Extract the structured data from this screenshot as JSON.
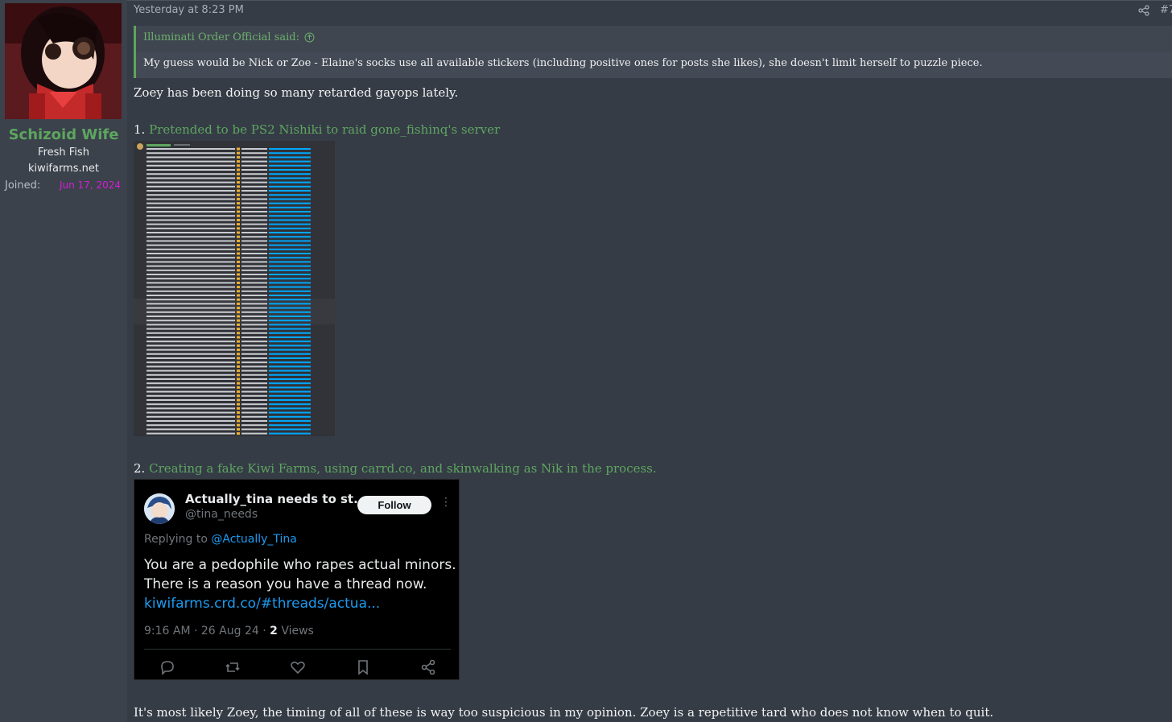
{
  "author": {
    "username": "Schizoid Wife",
    "title": "Fresh Fish",
    "site": "kiwifarms.net",
    "joined_label": "Joined:",
    "joined_date": "Jun 17, 2024",
    "avatar_icon": "anime-avatar-icon"
  },
  "post": {
    "timestamp": "Yesterday at 8:23 PM",
    "number": "#7",
    "quote": {
      "author_line": "Illuminati Order Official said:",
      "body": "My guess would be Nick or Zoe - Elaine's socks use all available stickers (including positive ones for posts she likes), she doesn't limit herself to puzzle piece."
    },
    "paragraph1": "Zoey has been doing so many retarded gayops lately.",
    "item1": {
      "prefix": "1. ",
      "link_text": "Pretended to be PS2 Nishiki to raid gone_fishinq's server"
    },
    "item2": {
      "prefix": "2. ",
      "link_text": "Creating a fake Kiwi Farms, using carrd.co, and skinwalking as Nik in the process."
    },
    "closing": "It's most likely Zoey, the timing of all of these is way too suspicious in my opinion. Zoey is a repetitive tard who does not know when to quit."
  },
  "tweet": {
    "display_name": "Actually_tina needs to st...",
    "handle": "@tina_needs",
    "follow_label": "Follow",
    "more_glyph": "⋮",
    "replying_prefix": "Replying to ",
    "replying_to": "@Actually_Tina",
    "body_line1": "You are a pedophile who rapes actual minors.",
    "body_line2": "There is a reason you have a thread now.",
    "body_link": "kiwifarms.crd.co/#threads/actua...",
    "meta_prefix": "9:16 AM · 26 Aug 24 · ",
    "views_count": "2",
    "views_label": " Views"
  },
  "colors": {
    "accent_green": "#5ea55f",
    "joined_date": "#d61ed6",
    "twitter_blue": "#1d9bf0",
    "background": "#353c46"
  }
}
